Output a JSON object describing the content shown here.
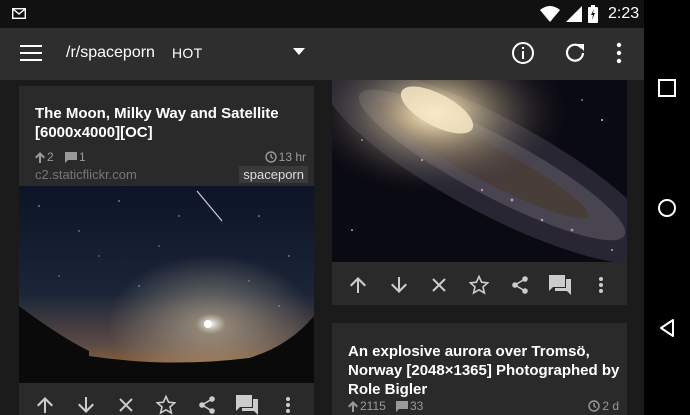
{
  "status": {
    "time": "2:23"
  },
  "appbar": {
    "subreddit": "/r/spaceporn",
    "sort": "HOT"
  },
  "posts": [
    {
      "title": "The Moon, Milky Way and Satellite [6000x4000][OC]",
      "votes": "2",
      "comments": "1",
      "age": "13 hr",
      "domain": "c2.staticflickr.com",
      "tag": "spaceporn"
    },
    {
      "title": "An explosive aurora over Tromsö, Norway [2048×1365] Photographed by Role Bigler",
      "votes": "2115",
      "comments": "33",
      "age": "2 d"
    }
  ],
  "colors": {
    "appbar": "#2e2e2e",
    "card": "#2a2a2a",
    "background": "#1b1b1b",
    "meta": "#9a9a9a"
  },
  "icons": [
    "mail-icon",
    "wifi-icon",
    "signal-icon",
    "battery-icon",
    "menu-icon",
    "dropdown-icon",
    "info-icon",
    "refresh-icon",
    "more-icon",
    "upvote-icon",
    "downvote-icon",
    "hide-icon",
    "star-icon",
    "share-icon",
    "comments-icon",
    "back-icon",
    "home-icon",
    "recents-icon"
  ]
}
